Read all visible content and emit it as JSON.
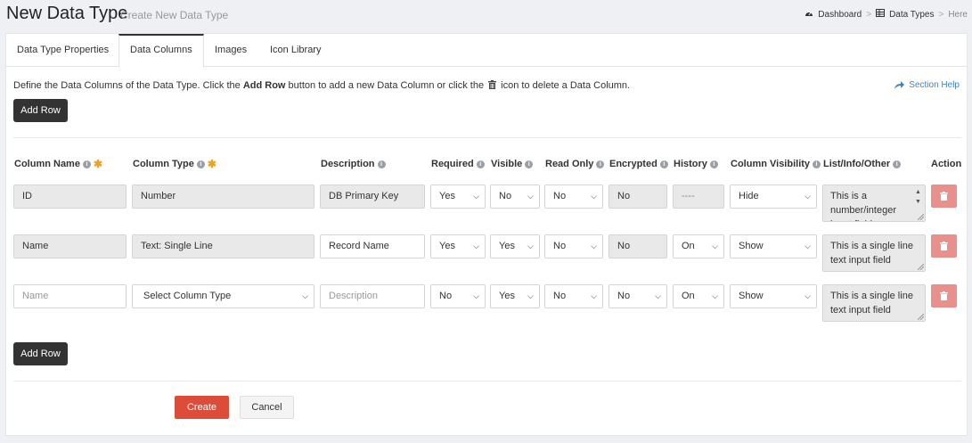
{
  "header": {
    "title": "New Data Type",
    "subtitle": "Create New Data Type",
    "breadcrumb": {
      "dashboard": "Dashboard",
      "data_types": "Data Types",
      "here": "Here",
      "separator": ">"
    }
  },
  "tabs": [
    "Data Type Properties",
    "Data Columns",
    "Images",
    "Icon Library"
  ],
  "active_tab": "Data Columns",
  "intro": {
    "part1": "Define the Data Columns of the Data Type. Click the ",
    "bold": "Add Row",
    "part2": " button to add a new Data Column or click the ",
    "part3": " icon to delete a Data Column."
  },
  "section_help": "Section Help",
  "add_row_label": "Add Row",
  "columns": {
    "name": "Column Name",
    "type": "Column Type",
    "description": "Description",
    "required": "Required",
    "visible": "Visible",
    "read_only": "Read Only",
    "encrypted": "Encrypted",
    "history": "History",
    "visibility": "Column Visibility",
    "list_info": "List/Info/Other",
    "action": "Action"
  },
  "rows": [
    {
      "name": "ID",
      "type": "Number",
      "description": "DB Primary Key",
      "required": "Yes",
      "visible": "No",
      "read_only": "No",
      "encrypted": "No",
      "history": "----",
      "visibility": "Hide",
      "list_info": "This is a number/integer input field"
    },
    {
      "name": "Name",
      "type": "Text: Single Line",
      "description": "Record Name",
      "required": "Yes",
      "visible": "Yes",
      "read_only": "No",
      "encrypted": "No",
      "history": "On",
      "visibility": "Show",
      "list_info": "This is a single line text input field"
    },
    {
      "name_placeholder": "Name",
      "type": "Select Column Type",
      "description_placeholder": "Description",
      "required": "No",
      "visible": "Yes",
      "read_only": "No",
      "encrypted": "No",
      "history": "On",
      "visibility": "Show",
      "list_info": "This is a single line text input field"
    }
  ],
  "buttons": {
    "create": "Create",
    "cancel": "Cancel"
  },
  "colors": {
    "danger": "#dd4b39",
    "delete": "#e9908c",
    "dark": "#333333",
    "link": "#3a86c8",
    "required_star": "#f0a020"
  }
}
